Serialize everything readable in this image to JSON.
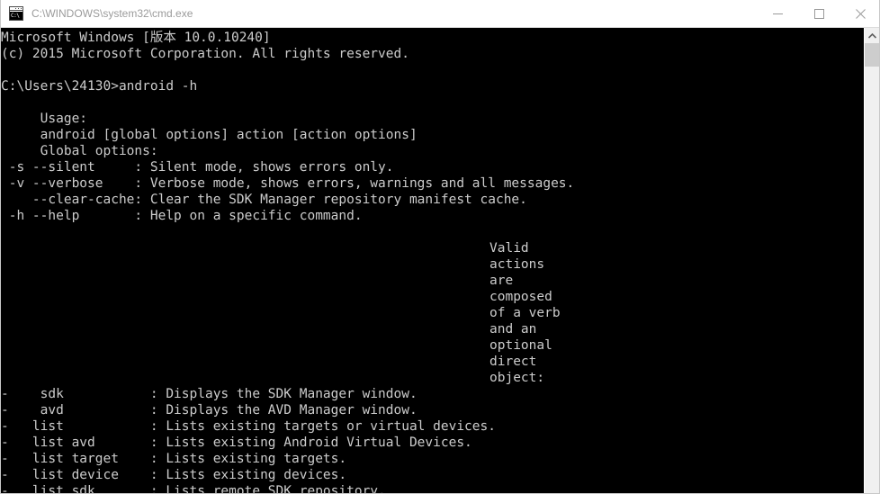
{
  "window": {
    "title": "C:\\WINDOWS\\system32\\cmd.exe",
    "icon_name": "cmd-exe-icon",
    "icon_text": "C:\\",
    "controls": {
      "minimize_label": "Minimize",
      "maximize_label": "Maximize",
      "close_label": "Close"
    },
    "colors": {
      "titlebar_bg": "#ffffff",
      "title_text": "#9b9b9b",
      "console_bg": "#000000",
      "console_text": "#cccccc",
      "scrollbar_track": "#f0f0f0",
      "scrollbar_thumb": "#cdcdcd"
    }
  },
  "console": {
    "lines": [
      "Microsoft Windows [版本 10.0.10240]",
      "(c) 2015 Microsoft Corporation. All rights reserved.",
      "",
      "C:\\Users\\24130>android -h",
      "",
      "     Usage:",
      "     android [global options] action [action options]",
      "     Global options:",
      " -s --silent     : Silent mode, shows errors only.",
      " -v --verbose    : Verbose mode, shows errors, warnings and all messages.",
      "    --clear-cache: Clear the SDK Manager repository manifest cache.",
      " -h --help       : Help on a specific command.",
      "",
      "",
      "",
      "",
      "",
      "",
      "",
      "",
      "",
      "",
      "-    sdk           : Displays the SDK Manager window.",
      "-    avd           : Displays the AVD Manager window.",
      "-   list           : Lists existing targets or virtual devices.",
      "-   list avd       : Lists existing Android Virtual Devices.",
      "-   list target    : Lists existing targets.",
      "-   list device    : Lists existing devices.",
      "-   list sdk       : Lists remote SDK repository."
    ],
    "side_block": [
      "Valid",
      "actions",
      "are",
      "composed",
      "of a verb",
      "and an",
      "optional",
      "direct",
      "object:"
    ]
  },
  "scrollbar": {
    "up_arrow_name": "scroll-up-arrow",
    "thumb_name": "scroll-thumb"
  }
}
